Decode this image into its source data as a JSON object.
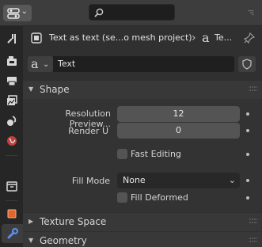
{
  "header": {
    "editor_type_icon": "properties-editor-icon",
    "search": {
      "placeholder": "",
      "icon": "search-icon"
    }
  },
  "tabs": [
    {
      "name": "tool",
      "icon": "tool-icon"
    },
    {
      "name": "render",
      "icon": "render-camera-icon"
    },
    {
      "name": "output",
      "icon": "output-printer-icon"
    },
    {
      "name": "view-layer",
      "icon": "view-layer-icon"
    },
    {
      "name": "scene",
      "icon": "scene-icon"
    },
    {
      "name": "world",
      "icon": "world-icon"
    },
    {
      "name": "collection",
      "icon": "collection-icon"
    },
    {
      "name": "object",
      "icon": "object-icon"
    },
    {
      "name": "modifiers",
      "icon": "wrench-icon"
    }
  ],
  "context": {
    "object_name": "Text as text (se...o mesh project)",
    "data_name": "Te...",
    "pin_icon": "pin-icon"
  },
  "datablock": {
    "name": "Text",
    "icon": "font-data-icon"
  },
  "panels": {
    "shape": {
      "label": "Shape",
      "resolution_preview_label": "Resolution Preview...",
      "resolution_preview_value": "12",
      "render_u_label": "Render U",
      "render_u_value": "0",
      "fast_editing_label": "Fast Editing",
      "fast_editing_checked": false,
      "fill_mode_label": "Fill Mode",
      "fill_mode_value": "None",
      "fill_deformed_label": "Fill Deformed",
      "fill_deformed_checked": false
    },
    "texture_space": {
      "label": "Texture Space",
      "expanded": false
    },
    "geometry": {
      "label": "Geometry",
      "expanded": true
    }
  },
  "colors": {
    "background": "#303030",
    "header": "#3d3d3d",
    "tab_strip": "#262626",
    "field": "#545454",
    "accent_object": "#e0662b",
    "accent_modifier": "#5a8de6"
  }
}
